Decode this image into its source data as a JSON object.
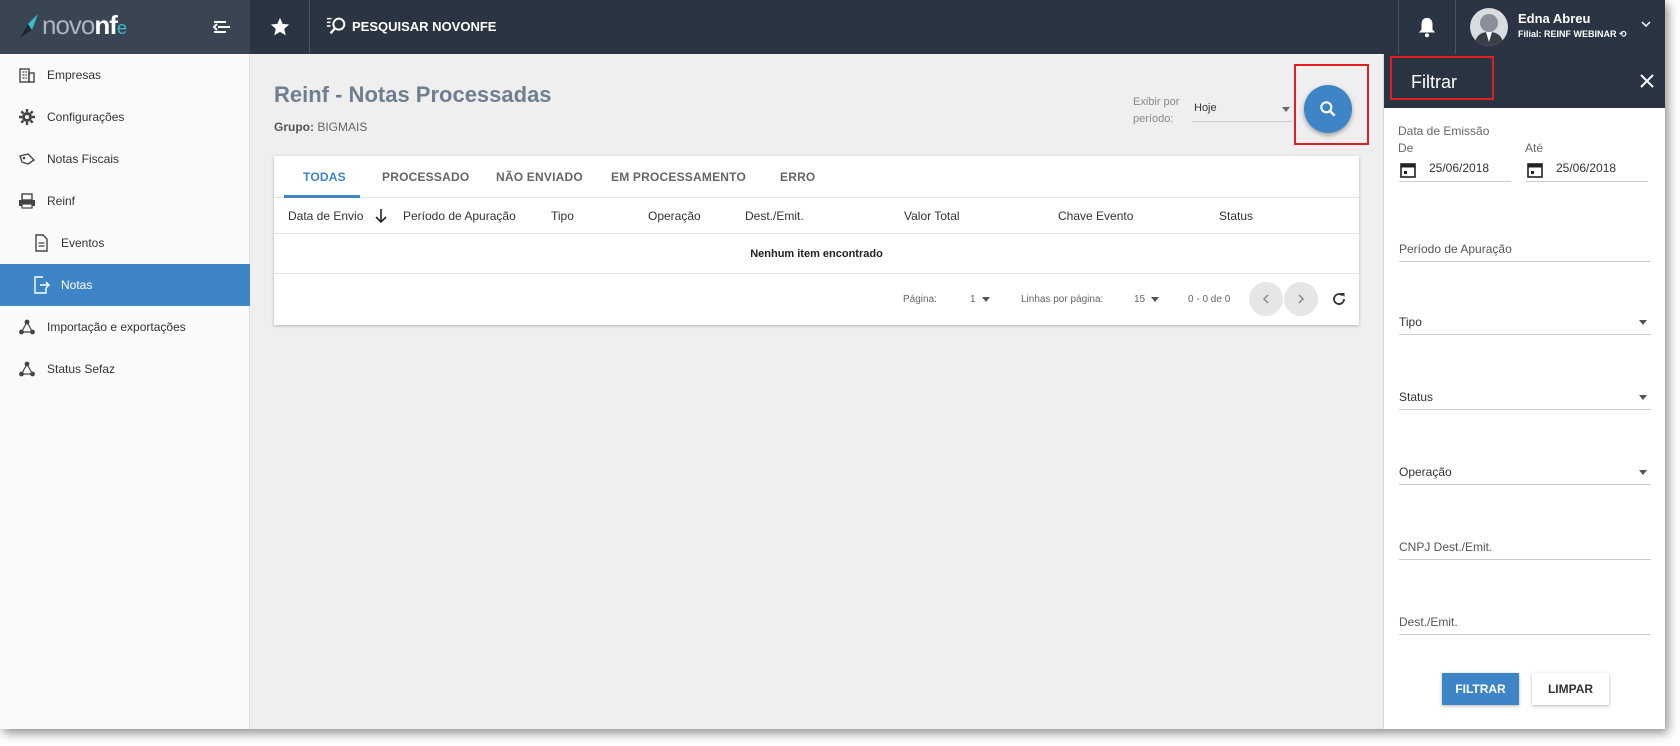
{
  "brand": {
    "logo_prefix": "novo",
    "logo_bold": "nf",
    "logo_suffix": "e"
  },
  "topbar": {
    "search_label": "PESQUISAR NOVONFE"
  },
  "user": {
    "name": "Edna Abreu",
    "filial": "Filial: REINF WEBINAR ⟲"
  },
  "sidebar": {
    "items": [
      {
        "label": "Empresas",
        "icon": "building-icon"
      },
      {
        "label": "Configurações",
        "icon": "gear-icon"
      },
      {
        "label": "Notas Fiscais",
        "icon": "tag-icon"
      },
      {
        "label": "Reinf",
        "icon": "printer-icon"
      },
      {
        "label": "Eventos",
        "icon": "document-icon"
      },
      {
        "label": "Notas",
        "icon": "export-icon",
        "active": true
      },
      {
        "label": "Importação e exportações",
        "icon": "network-icon"
      },
      {
        "label": "Status Sefaz",
        "icon": "network-icon"
      }
    ]
  },
  "page": {
    "title": "Reinf - Notas Processadas",
    "group_label": "Grupo:",
    "group_value": "BIGMAIS",
    "period_label": "Exibir por período:",
    "period_value": "Hoje"
  },
  "tabs": [
    "TODAS",
    "PROCESSADO",
    "NÃO ENVIADO",
    "EM PROCESSAMENTO",
    "ERRO"
  ],
  "table": {
    "columns": [
      "Data de Envio",
      "Período de Apuração",
      "Tipo",
      "Operação",
      "Dest./Emit.",
      "Valor Total",
      "Chave Evento",
      "Status"
    ],
    "empty_message": "Nenhum item encontrado",
    "footer": {
      "page_label": "Página:",
      "page_value": "1",
      "rows_label": "Linhas por página:",
      "rows_value": "15",
      "range": "0 - 0 de 0"
    }
  },
  "filter": {
    "title": "Filtrar",
    "date_group_label": "Data de Emissão",
    "from_label": "De",
    "from_value": "25/06/2018",
    "to_label": "Até",
    "to_value": "25/06/2018",
    "fields": {
      "periodo": "Período de Apuração",
      "tipo": "Tipo",
      "status": "Status",
      "operacao": "Operação",
      "cnpj": "CNPJ Dest./Emit.",
      "dest": "Dest./Emit."
    },
    "apply_label": "FILTRAR",
    "clear_label": "LIMPAR"
  },
  "colors": {
    "primary": "#3d85c6",
    "topbar": "#2a3442",
    "highlight_box": "#e02020"
  }
}
